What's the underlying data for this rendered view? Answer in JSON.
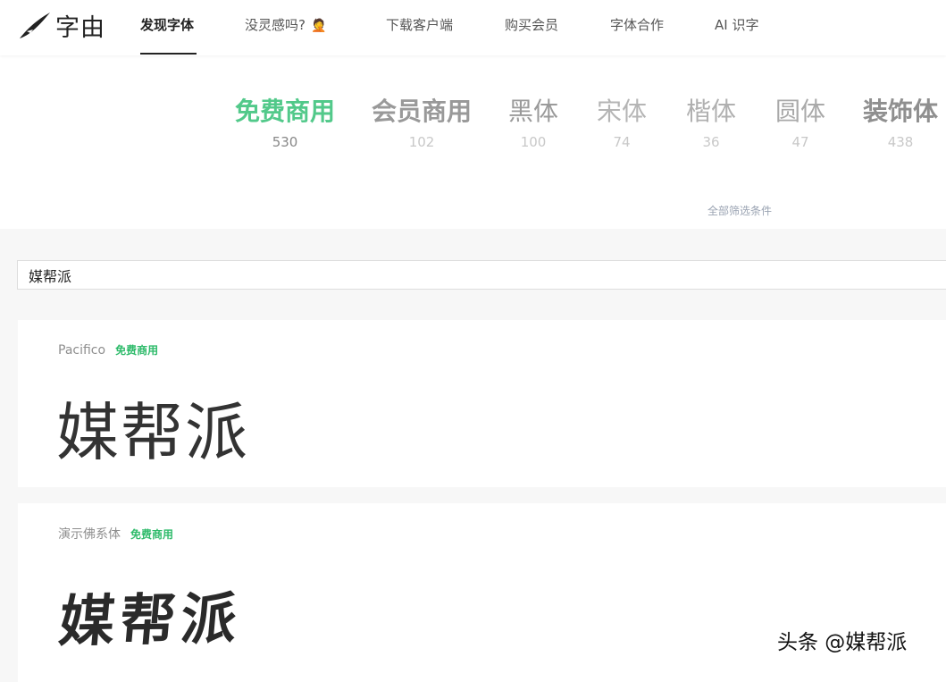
{
  "logo": {
    "text": "字由"
  },
  "nav": {
    "discover": "发现字体",
    "inspiration": "没灵感吗?",
    "download": "下载客户端",
    "membership": "购买会员",
    "cooperation": "字体合作",
    "ai": "AI 识字"
  },
  "categories": [
    {
      "label": "免费商用",
      "count": "530",
      "color": "#52c98a",
      "count_color": "#888888"
    },
    {
      "label": "会员商用",
      "count": "102",
      "color": "#999999",
      "count_color": "#c8c8c8"
    },
    {
      "label": "黑体",
      "count": "100",
      "color": "#9a9a9a",
      "count_color": "#c8c8c8"
    },
    {
      "label": "宋体",
      "count": "74",
      "color": "#b5b5b5",
      "count_color": "#c8c8c8"
    },
    {
      "label": "楷体",
      "count": "36",
      "color": "#b0b0b0",
      "count_color": "#c8c8c8"
    },
    {
      "label": "圆体",
      "count": "47",
      "color": "#a9a9a9",
      "count_color": "#c8c8c8"
    },
    {
      "label": "装饰体",
      "count": "438",
      "color": "#8f8f8f",
      "count_color": "#c8c8c8"
    }
  ],
  "filter": {
    "all_conditions": "全部筛选条件"
  },
  "search": {
    "value": "媒帮派"
  },
  "fonts": [
    {
      "name": "Pacifico",
      "badge": "免费商用",
      "sample": "媒帮派"
    },
    {
      "name": "演示佛系体",
      "badge": "免费商用",
      "sample": "媒帮派"
    }
  ],
  "watermark": "头条 @媒帮派",
  "icons": {
    "logo": "feather-brush-icon",
    "inspiration": "thinking-person-emoji-icon"
  }
}
